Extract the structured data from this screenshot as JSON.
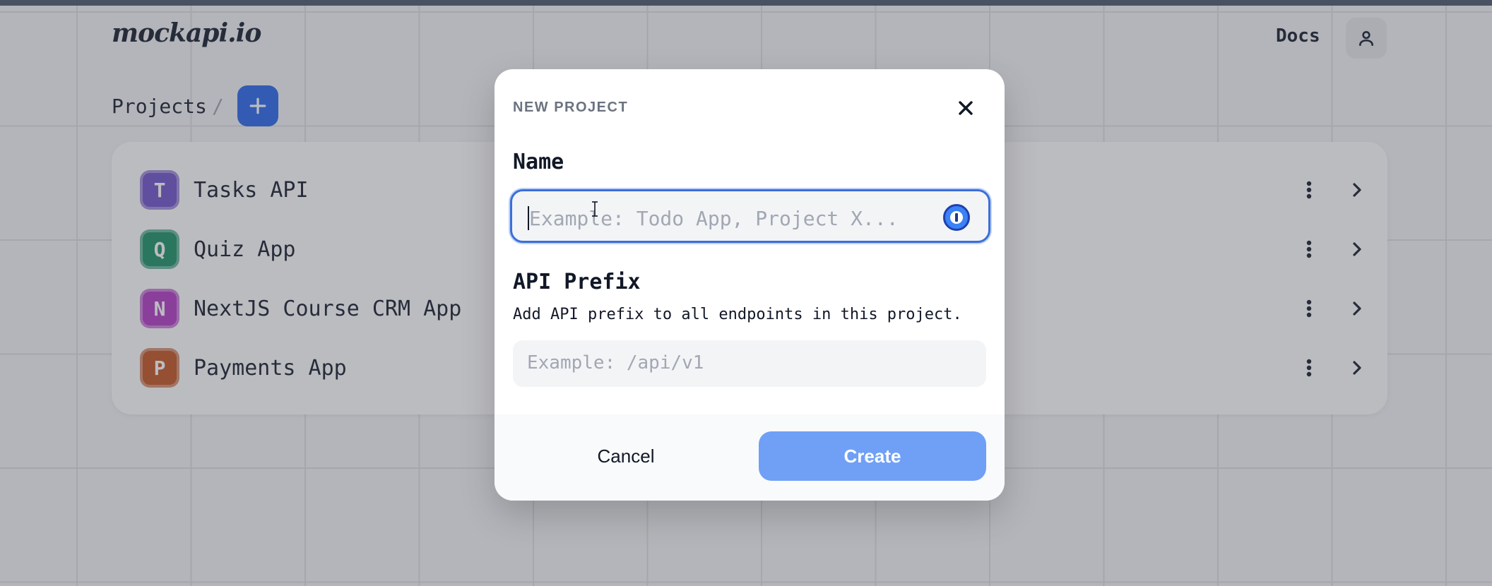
{
  "app": {
    "logo": "mockapi.io"
  },
  "header": {
    "docs_label": "Docs",
    "avatar_icon": "user-icon"
  },
  "breadcrumb": {
    "projects_label": "Projects",
    "separator": "/",
    "add_icon": "plus-icon"
  },
  "projects": [
    {
      "initial": "T",
      "name": "Tasks API",
      "color": "#6d4fc9"
    },
    {
      "initial": "Q",
      "name": "Quiz App",
      "color": "#178f63"
    },
    {
      "initial": "N",
      "name": "NextJS Course CRM App",
      "color": "#b037c4"
    },
    {
      "initial": "P",
      "name": "Payments App",
      "color": "#c2501c"
    }
  ],
  "modal": {
    "title": "NEW PROJECT",
    "close_icon": "close-icon",
    "name_label": "Name",
    "name_placeholder": "Example: Todo App, Project X...",
    "name_value": "",
    "prefix_label": "API Prefix",
    "prefix_help": "Add API prefix to all endpoints in this project.",
    "prefix_placeholder": "Example: /api/v1",
    "prefix_value": "",
    "cancel_label": "Cancel",
    "create_label": "Create"
  },
  "colors": {
    "accent": "#2563eb",
    "create_disabled": "#6fa0f6",
    "focus_border": "#3b6fd8"
  }
}
